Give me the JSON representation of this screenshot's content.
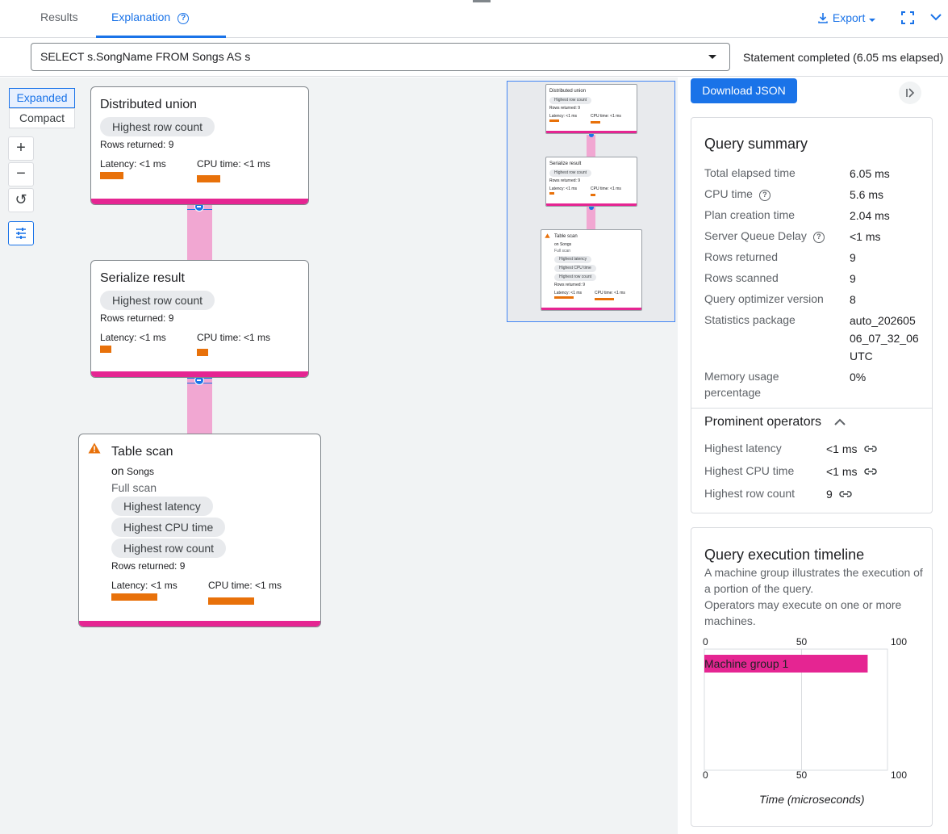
{
  "tabs": [
    {
      "label": "Results",
      "active": false
    },
    {
      "label": "Explanation",
      "active": true
    }
  ],
  "toolbar": {
    "export_label": "Export"
  },
  "query": {
    "text": "SELECT s.SongName FROM Songs AS s",
    "status": "Statement completed (6.05 ms elapsed)"
  },
  "view_toggle": {
    "expanded": "Expanded",
    "compact": "Compact",
    "selected": "Expanded"
  },
  "zoom": {
    "in": "+",
    "out": "−",
    "reset": "↺"
  },
  "nodes": [
    {
      "title": "Distributed union",
      "chips": [
        "Highest row count"
      ],
      "rows_returned": "Rows returned: 9",
      "latency": "Latency: <1 ms",
      "cpu": "CPU time: <1 ms"
    },
    {
      "title": "Serialize result",
      "chips": [
        "Highest row count"
      ],
      "rows_returned": "Rows returned: 9",
      "latency": "Latency: <1 ms",
      "cpu": "CPU time: <1 ms"
    },
    {
      "title": "Table scan",
      "on_prefix": "on",
      "on_table": "Songs",
      "scan_type": "Full scan",
      "chips": [
        "Highest latency",
        "Highest CPU time",
        "Highest row count"
      ],
      "rows_returned": "Rows returned: 9",
      "latency": "Latency: <1 ms",
      "cpu": "CPU time: <1 ms"
    }
  ],
  "panel": {
    "download_label": "Download JSON",
    "summary": {
      "title": "Query summary",
      "rows": [
        {
          "label": "Total elapsed time",
          "value": "6.05 ms"
        },
        {
          "label": "CPU time",
          "value": "5.6 ms"
        },
        {
          "label": "Plan creation time",
          "value": "2.04 ms"
        },
        {
          "label": "Server Queue Delay",
          "value": "<1 ms"
        },
        {
          "label": "Rows returned",
          "value": "9"
        },
        {
          "label": "Rows scanned",
          "value": "9"
        },
        {
          "label": "Query optimizer version",
          "value": "8"
        },
        {
          "label": "Statistics package",
          "value": "auto_20260506_07_32_06UTC",
          "value_lines": [
            "auto_202605",
            "06_07_32_06",
            "UTC"
          ]
        },
        {
          "label": "Memory usage percentage",
          "label_lines": [
            "Memory usage",
            "percentage"
          ],
          "value": "0%"
        }
      ]
    },
    "prominent": {
      "title": "Prominent operators",
      "rows": [
        {
          "label": "Highest latency",
          "value": "<1 ms"
        },
        {
          "label": "Highest CPU time",
          "value": "<1 ms"
        },
        {
          "label": "Highest row count",
          "value": "9"
        }
      ]
    },
    "timeline": {
      "title": "Query execution timeline",
      "desc1": "A machine group illustrates the execution of a portion of the query.",
      "desc2": "Operators may execute on one or more machines.",
      "axis_title": "Time (microseconds)"
    }
  },
  "chart_data": {
    "type": "bar",
    "orientation": "horizontal",
    "categories": [
      "Machine group 1"
    ],
    "values": [
      84
    ],
    "xlim": [
      0,
      100
    ],
    "xticks": [
      "0",
      "50",
      "100"
    ],
    "xlabel": "Time (microseconds)",
    "color": "#e52592"
  },
  "colors": {
    "accent": "#1a73e8",
    "node_footer": "#e52592",
    "metric_bar": "#e8710a",
    "edge": "#f1a7d2",
    "warning": "#e8710a"
  }
}
